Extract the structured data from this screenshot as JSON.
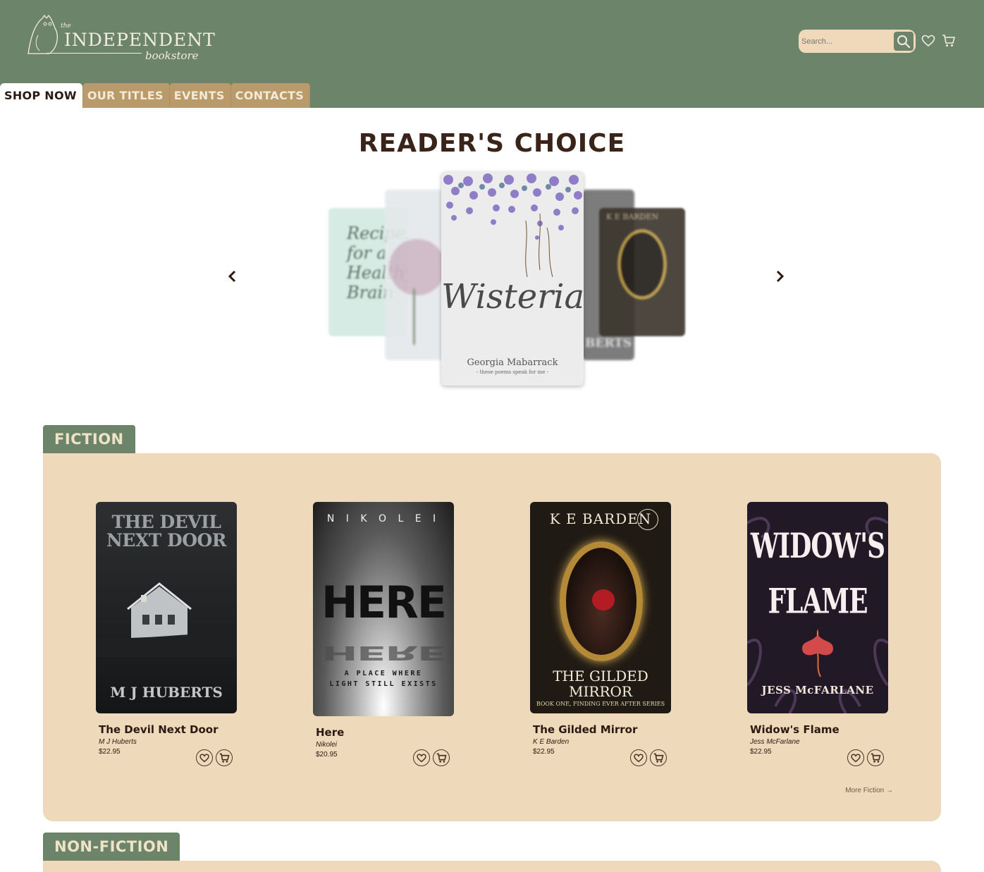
{
  "header": {
    "logo": {
      "the": "the",
      "name": "INDEPENDENT",
      "sub": "bookstore"
    },
    "search": {
      "placeholder": "Search..."
    },
    "icons": [
      "search-icon",
      "heart-icon",
      "cart-icon"
    ]
  },
  "nav": {
    "tabs": [
      {
        "label": "SHOP NOW",
        "active": true
      },
      {
        "label": "OUR TITLES",
        "active": false
      },
      {
        "label": "EVENTS",
        "active": false
      },
      {
        "label": "CONTACTS",
        "active": false
      }
    ]
  },
  "carousel": {
    "title": "READER'S CHOICE",
    "featured": {
      "title": "Wisteria",
      "author": "Georgia Mabarrack",
      "tagline": "- these poems speak for me -"
    },
    "side_books": [
      {
        "text": "Recipes for a Healthy Brain"
      },
      {
        "text": ""
      },
      {
        "text": "BERTS"
      },
      {
        "text": "K E BARDEN"
      }
    ]
  },
  "fiction": {
    "label": "FICTION",
    "more": "More Fiction →",
    "books": [
      {
        "title": "The Devil Next Door",
        "author": "M J Huberts",
        "price": "$22.95",
        "cover_title": "THE DEVIL NEXT DOOR",
        "cover_author": "M J HUBERTS"
      },
      {
        "title": "Here",
        "author": "Nikolei",
        "price": "$20.95",
        "cover_title": "HERE",
        "cover_author": "N I K O L E I",
        "cover_tagline": "A PLACE WHERE LIGHT STILL EXISTS"
      },
      {
        "title": "The Gilded Mirror",
        "author": "K E Barden",
        "price": "$22.95",
        "cover_title": "THE GILDED MIRROR",
        "cover_author": "K E BARDEN",
        "cover_tagline": "BOOK ONE, FINDING EVER AFTER SERIES"
      },
      {
        "title": "Widow's Flame",
        "author": "Jess McFarlane",
        "price": "$22.95",
        "cover_title": "WIDOW'S FLAME",
        "cover_author": "JESS McFARLANE"
      }
    ]
  },
  "nonfiction": {
    "label": "NON-FICTION"
  },
  "colors": {
    "green": "#6b846a",
    "tan": "#efd9bb",
    "tab": "#b99b6b",
    "dark": "#2b1a12"
  }
}
